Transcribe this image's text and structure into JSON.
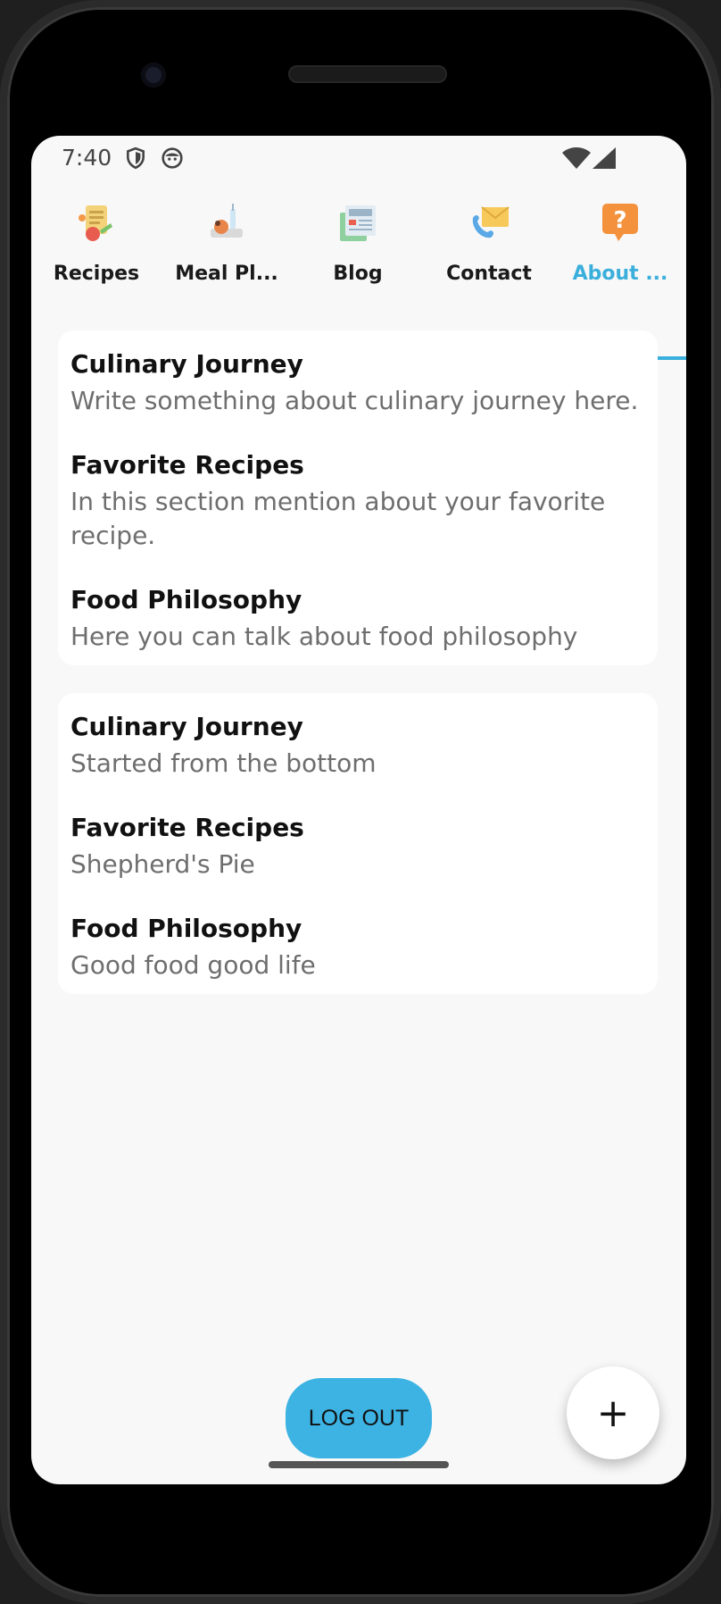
{
  "status_bar": {
    "time": "7:40",
    "icons": [
      "shield-icon",
      "face-icon",
      "wifi-icon",
      "cellular-signal-icon"
    ]
  },
  "tabs": [
    {
      "label": "Recipes",
      "icon": "recipes-icon",
      "active": false
    },
    {
      "label": "Meal Pl...",
      "icon": "meal-plan-icon",
      "active": false
    },
    {
      "label": "Blog",
      "icon": "blog-icon",
      "active": false
    },
    {
      "label": "Contact",
      "icon": "contact-icon",
      "active": false
    },
    {
      "label": "About ...",
      "icon": "about-question-icon",
      "active": true
    }
  ],
  "cards": [
    {
      "items": [
        {
          "title": "Culinary Journey",
          "text": "Write something about culinary journey here."
        },
        {
          "title": "Favorite Recipes",
          "text": "In this section mention about your favorite recipe."
        },
        {
          "title": "Food Philosophy",
          "text": "Here you can talk about food philosophy"
        }
      ]
    },
    {
      "items": [
        {
          "title": "Culinary Journey",
          "text": "Started from the bottom"
        },
        {
          "title": "Favorite Recipes",
          "text": "Shepherd's Pie"
        },
        {
          "title": "Food Philosophy",
          "text": "Good food good life"
        }
      ]
    }
  ],
  "actions": {
    "logout_label": "LOG OUT",
    "fab_label": "+"
  },
  "colors": {
    "accent": "#3aafdc",
    "logout_button": "#3db3e3",
    "background": "#f8f8f8"
  }
}
